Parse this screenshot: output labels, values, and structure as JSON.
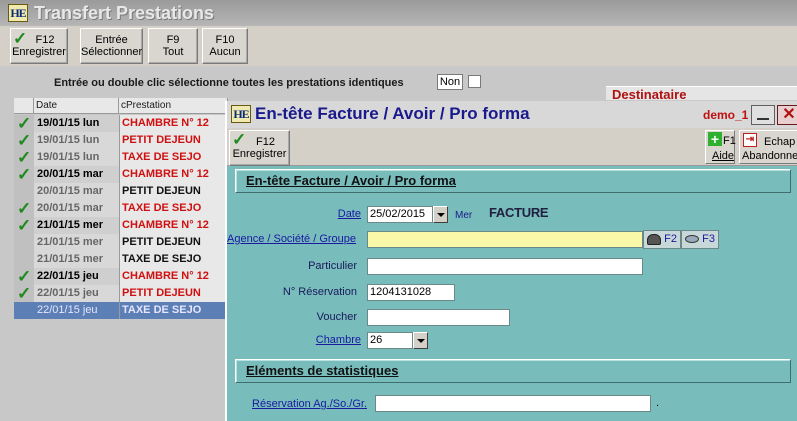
{
  "app": {
    "title": "Transfert Prestations",
    "logo_text": "HE"
  },
  "toolbar": [
    {
      "key": "F12",
      "label": "Enregistrer"
    },
    {
      "key": "Entrée",
      "label": "Sélectionner"
    },
    {
      "key": "F9",
      "label": "Tout"
    },
    {
      "key": "F10",
      "label": "Aucun"
    }
  ],
  "hint": {
    "text": "Entrée ou double clic sélectionne toutes les prestations identiques",
    "toggle_value": "Non"
  },
  "destinataire_label": "Destinataire",
  "grid": {
    "columns": [
      "Date",
      "cPrestation"
    ],
    "rows": [
      {
        "date": "19/01/15 lun",
        "prestation": "CHAMBRE N° 12"
      },
      {
        "date": "19/01/15 lun",
        "prestation": "PETIT DEJEUN"
      },
      {
        "date": "19/01/15 lun",
        "prestation": "TAXE DE SEJO"
      },
      {
        "date": "20/01/15 mar",
        "prestation": "CHAMBRE N° 12"
      },
      {
        "date": "20/01/15 mar",
        "prestation": "PETIT DEJEUN"
      },
      {
        "date": "20/01/15 mar",
        "prestation": "TAXE DE SEJO"
      },
      {
        "date": "21/01/15 mer",
        "prestation": "CHAMBRE N° 12"
      },
      {
        "date": "21/01/15 mer",
        "prestation": "PETIT DEJEUN"
      },
      {
        "date": "21/01/15 mer",
        "prestation": "TAXE DE SEJO"
      },
      {
        "date": "22/01/15 jeu",
        "prestation": "CHAMBRE N° 12"
      },
      {
        "date": "22/01/15 jeu",
        "prestation": "PETIT DEJEUN"
      },
      {
        "date": "22/01/15 jeu",
        "prestation": "TAXE DE SEJO"
      }
    ]
  },
  "dialog": {
    "title": "En-tête Facture / Avoir / Pro forma",
    "logo_text": "HE",
    "user": "demo_1",
    "save_key": "F12",
    "save_label": "Enregistrer",
    "help_key": "F1",
    "help_label": "Aide",
    "abandon_key": "Echap",
    "abandon_label": "Abandonner",
    "section_header": "En-tête Facture / Avoir / Pro forma",
    "date_label": "Date",
    "date_value": "25/02/2015",
    "date_day": "Mer",
    "doc_type": "FACTURE",
    "agence_label": "Agence / Société / Groupe",
    "agence_value": "",
    "f2_label": "F2",
    "f3_label": "F3",
    "particulier_label": "Particulier",
    "particulier_value": "",
    "reservation_label": "N° Réservation",
    "reservation_value": "1204131028",
    "voucher_label": "Voucher",
    "voucher_value": "",
    "chambre_label": "Chambre",
    "chambre_value": "26",
    "stats_header": "Eléments de statistiques",
    "resa_ag_label": "Réservation Ag./So./Gr.",
    "resa_ag_value": "",
    "resa_ag_suffix": "."
  }
}
